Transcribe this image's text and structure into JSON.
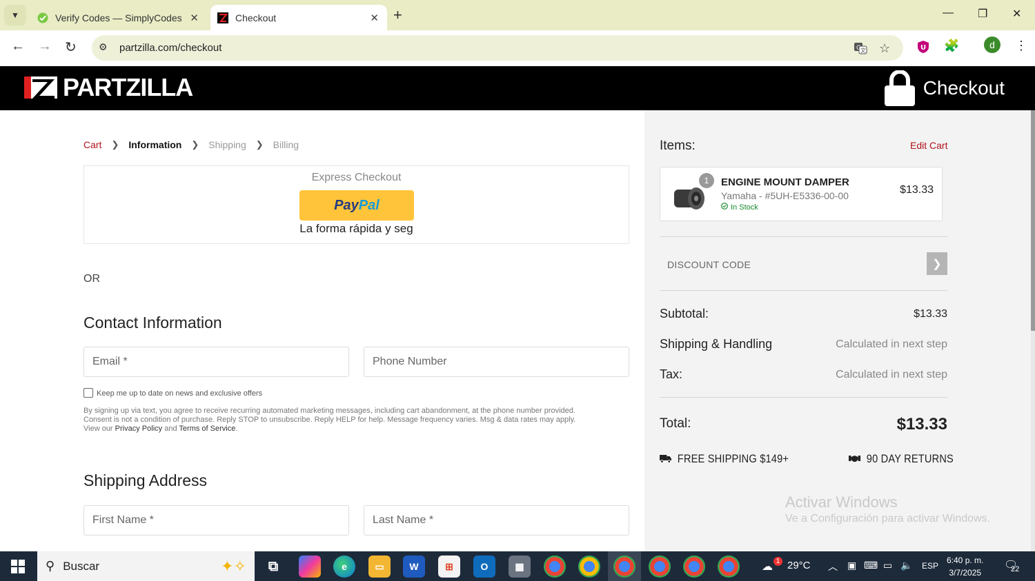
{
  "browser": {
    "tabs": [
      {
        "title": "Verify Codes — SimplyCodes",
        "icon": "simplycodes-icon"
      },
      {
        "title": "Checkout",
        "icon": "partzilla-icon",
        "active": true
      }
    ],
    "url": "partzilla.com/checkout",
    "profile_initial": "d"
  },
  "site": {
    "logo_text": "PARTZILLA",
    "header_title": "Checkout"
  },
  "breadcrumb": [
    {
      "label": "Cart",
      "state": "link"
    },
    {
      "label": "Information",
      "state": "current"
    },
    {
      "label": "Shipping",
      "state": "upcoming"
    },
    {
      "label": "Billing",
      "state": "upcoming"
    }
  ],
  "express": {
    "label": "Express Checkout",
    "paypal_pay": "Pay",
    "paypal_pal": "Pal",
    "tagline": "La forma rápida y seg"
  },
  "or_text": "OR",
  "contact": {
    "heading": "Contact Information",
    "email_placeholder": "Email *",
    "phone_placeholder": "Phone Number",
    "newsletter_label": "Keep me up to date on news and exclusive offers",
    "legal_line1": "By signing up via text, you agree to receive recurring automated marketing messages, including cart abandonment, at the phone number provided.",
    "legal_line2": "Consent is not a condition of purchase. Reply STOP to unsubscribe. Reply HELP for help. Message frequency varies. Msg & data rates may apply.",
    "legal_view": "View our",
    "privacy_link": "Privacy Policy",
    "legal_and": "and",
    "terms_link": "Terms of Service",
    "legal_end": "."
  },
  "shipping": {
    "heading": "Shipping Address",
    "first_name_placeholder": "First Name *",
    "last_name_placeholder": "Last Name *"
  },
  "summary": {
    "items_title": "Items:",
    "edit_cart": "Edit Cart",
    "item": {
      "qty": "1",
      "name": "ENGINE MOUNT DAMPER",
      "sub": "Yamaha - #5UH-E5336-00-00",
      "stock": "In Stock",
      "price": "$13.33"
    },
    "discount_label": "DISCOUNT CODE",
    "subtotal_label": "Subtotal:",
    "subtotal_value": "$13.33",
    "shipping_label": "Shipping & Handling",
    "shipping_value": "Calculated in next step",
    "tax_label": "Tax:",
    "tax_value": "Calculated in next step",
    "total_label": "Total:",
    "total_value": "$13.33",
    "perk_shipping": "FREE SHIPPING $149+",
    "perk_returns": "90 DAY RETURNS",
    "watermark_title": "Activar Windows",
    "watermark_sub": "Ve a Configuración para activar Windows."
  },
  "taskbar": {
    "search_text": "Buscar",
    "weather": "29°C",
    "weather_badge": "1",
    "language": "ESP",
    "time": "6:40 p. m.",
    "date": "3/7/2025",
    "notifications": "22"
  },
  "colors": {
    "tabbar_bg": "#e9ecc5",
    "header_bg": "#000000",
    "accent_red": "#b0121b",
    "paypal_yellow": "#ffc439",
    "summary_bg": "#f3f3f3",
    "in_stock_green": "#1a8a2e",
    "taskbar_bg": "#1d2a3a"
  }
}
